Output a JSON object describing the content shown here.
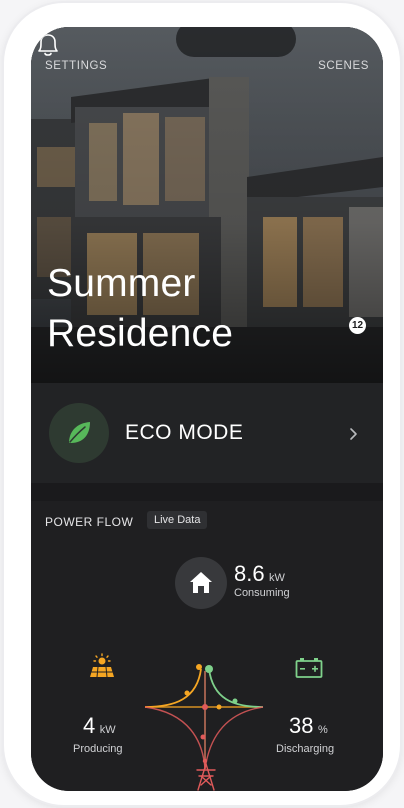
{
  "nav": {
    "settings": "SETTINGS",
    "scenes": "SCENES"
  },
  "hero": {
    "title_line1": "Summer",
    "title_line2": "Residence",
    "notification_count": "12"
  },
  "eco": {
    "label": "ECO MODE",
    "icon": "leaf-icon",
    "accent": "#4caf50"
  },
  "power_flow": {
    "label": "POWER FLOW",
    "badge": "Live Data",
    "consuming": {
      "value": "8.6",
      "unit": "kW",
      "label": "Consuming",
      "icon": "home-icon"
    },
    "producing": {
      "value": "4",
      "unit": "kW",
      "label": "Producing",
      "icon": "solar-icon",
      "color": "#f5a623"
    },
    "battery": {
      "value": "38",
      "unit": "%",
      "label": "Discharging",
      "icon": "battery-icon",
      "color": "#7fd18b"
    },
    "grid": {
      "icon": "grid-tower-icon",
      "color": "#e05a5a"
    }
  }
}
